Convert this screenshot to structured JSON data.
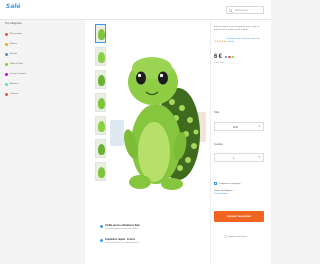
{
  "brand": {
    "logo_text": "Salé"
  },
  "search": {
    "text": "Rechercher"
  },
  "sidebar": {
    "title": "Top catégories",
    "items": [
      {
        "label": "Électronique",
        "color": "#e2574c"
      },
      {
        "label": "Maison",
        "color": "#f5a623"
      },
      {
        "label": "Beauté",
        "color": "#4a90d9"
      },
      {
        "label": "Mode & Style",
        "color": "#7ed321"
      },
      {
        "label": "Jouets & enfants",
        "color": "#bd10e0"
      },
      {
        "label": "Animaux",
        "color": "#50e3c2"
      },
      {
        "label": "Cadeaux",
        "color": "#e2574c"
      }
    ]
  },
  "product": {
    "title": "Peluche tortue verte aux grands yeux, jouet en peluche doux, cadeau pour enfants",
    "rating_stars": 5,
    "review_link": "Evaluations des clients et notes des produits",
    "price": "6 €",
    "price_note": "TVA incluse"
  },
  "options": {
    "size_label": "Taille",
    "size_value": "Petit",
    "qty_label": "Quantité",
    "qty_value": "1"
  },
  "delivery": {
    "row1_title": "Vérifié par les utilisateurs Salé",
    "row1_sub": "Les commentaires et avis des clients",
    "row2_title": "Expédition rapide · France",
    "row2_sub": "Livraison estimée sous quelques jours"
  },
  "store": {
    "check_label": "Comparer ce magasin",
    "line1": "Vendu par Magasin",
    "line2": "Voir la boutique"
  },
  "actions": {
    "buy_label": "Ajouter au panier",
    "wish_label": "Ajouter aux favoris"
  },
  "colors": {
    "accent": "#3b9ae8",
    "buy": "#f1641f",
    "plush_green": "#7fc33b"
  },
  "gallery": {
    "thumb_count": 7
  }
}
